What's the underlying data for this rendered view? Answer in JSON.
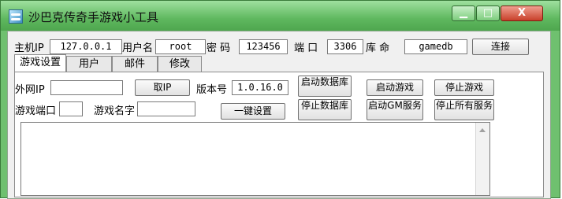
{
  "window": {
    "title": "沙巴克传奇手游戏小工具",
    "controls": {
      "minimize": "▁",
      "maximize": "□",
      "close": "X"
    }
  },
  "connection": {
    "host_label": "主机IP",
    "host_value": "127.0.0.1",
    "user_label": "用户名",
    "user_value": "root",
    "password_label": "密  码",
    "password_value": "123456",
    "port_label": "端  口",
    "port_value": "3306",
    "dbname_label": "库  命",
    "dbname_value": "gamedb",
    "connect_button": "连接"
  },
  "tabs": [
    {
      "label": "游戏设置",
      "active": true
    },
    {
      "label": "用户",
      "active": false
    },
    {
      "label": "邮件",
      "active": false
    },
    {
      "label": "修改",
      "active": false
    }
  ],
  "game_settings": {
    "external_ip_label": "外网IP",
    "external_ip_value": "",
    "get_ip_button": "取IP",
    "version_label": "版本号",
    "version_value": "1.0.16.0",
    "game_port_label": "游戏端口",
    "game_port_value": "",
    "game_name_label": "游戏名字",
    "game_name_value": "",
    "one_click_setup_button": "一键设置",
    "start_database_button": "启动数据库",
    "stop_database_button": "停止数据库",
    "start_game_button": "启动游戏",
    "start_gm_service_button": "启动GM服务",
    "stop_game_button": "停止游戏",
    "stop_all_services_button": "停止所有服务",
    "log_text": ""
  }
}
